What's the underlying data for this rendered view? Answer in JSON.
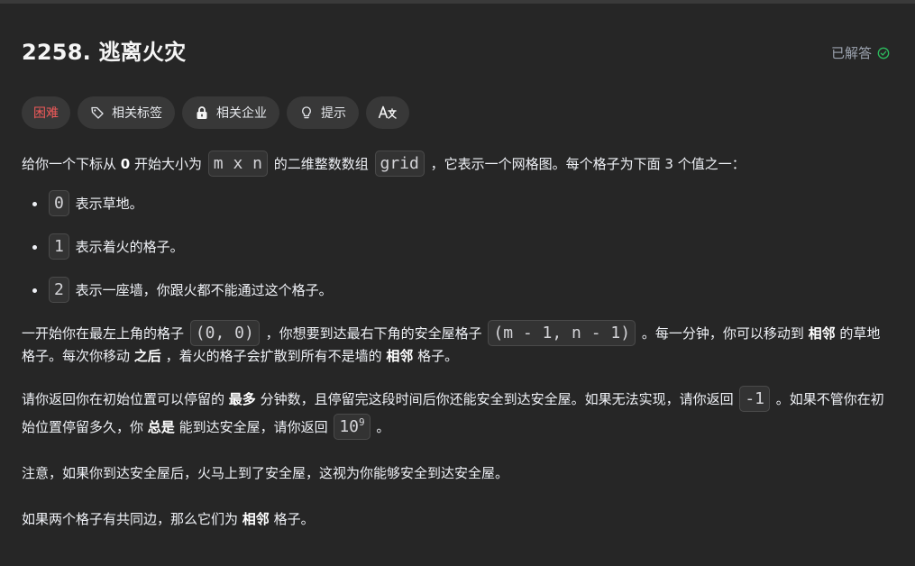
{
  "problem": {
    "title": "2258. 逃离火灾",
    "solved_label": "已解答"
  },
  "tags": {
    "difficulty": "困难",
    "related_tags": "相关标签",
    "related_companies": "相关企业",
    "hint": "提示"
  },
  "colors": {
    "background": "#262626",
    "difficulty_hard": "#f05a5a",
    "solved_check": "#2cbb5d"
  },
  "desc": {
    "p1": {
      "t1": "给你一个下标从 ",
      "b1": "0",
      "t2": " 开始大小为 ",
      "c1": "m x n",
      "t3": " 的二维整数数组 ",
      "c2": "grid",
      "t4": " ，它表示一个网格图。每个格子为下面 3 个值之一："
    },
    "items": [
      {
        "code": "0",
        "text": " 表示草地。"
      },
      {
        "code": "1",
        "text": " 表示着火的格子。"
      },
      {
        "code": "2",
        "text": " 表示一座墙，你跟火都不能通过这个格子。"
      }
    ],
    "p2": {
      "t1": "一开始你在最左上角的格子 ",
      "c1": "(0, 0)",
      "t2": " ，你想要到达最右下角的安全屋格子 ",
      "c2": "(m - 1, n - 1)",
      "t3": " 。每一分钟，你可以移动到 ",
      "b1": "相邻",
      "t4": " 的草地格子。每次你移动 ",
      "b2": "之后",
      "t5": " ，着火的格子会扩散到所有不是墙的 ",
      "b3": "相邻",
      "t6": " 格子。"
    },
    "p3": {
      "t1": "请你返回你在初始位置可以停留的 ",
      "b1": "最多",
      "t2": " 分钟数，且停留完这段时间后你还能安全到达安全屋。如果无法实现，请你返回 ",
      "c1": "-1",
      "t3": " 。如果不管你在初始位置停留多久，你 ",
      "b2": "总是",
      "t4": " 能到达安全屋，请你返回 ",
      "c2_base": "10",
      "c2_exp": "9",
      "t5": " 。"
    },
    "p4": "注意，如果你到达安全屋后，火马上到了安全屋，这视为你能够安全到达安全屋。",
    "p5": {
      "t1": "如果两个格子有共同边，那么它们为 ",
      "b1": "相邻",
      "t2": " 格子。"
    }
  }
}
